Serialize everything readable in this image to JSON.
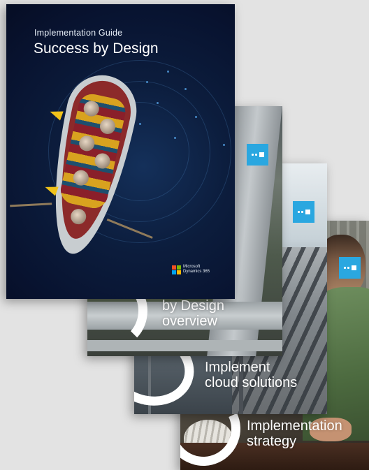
{
  "cover": {
    "eyebrow": "Implementation Guide",
    "title": "Success by Design",
    "brand_line1": "Microsoft",
    "brand_line2": "Dynamics 365"
  },
  "docs": [
    {
      "line1": "by Design",
      "line2": "overview"
    },
    {
      "line1": "Implement",
      "line2": "cloud solutions"
    },
    {
      "line1": "Implementation",
      "line2": "strategy"
    }
  ],
  "colors": {
    "background": "#e3e3e3",
    "cover_navy": "#0c1d3d",
    "badge_blue": "#2aa7e0"
  },
  "icons": {
    "logo": "microsoft-logo",
    "badge": "success-by-design-badge-icon"
  }
}
